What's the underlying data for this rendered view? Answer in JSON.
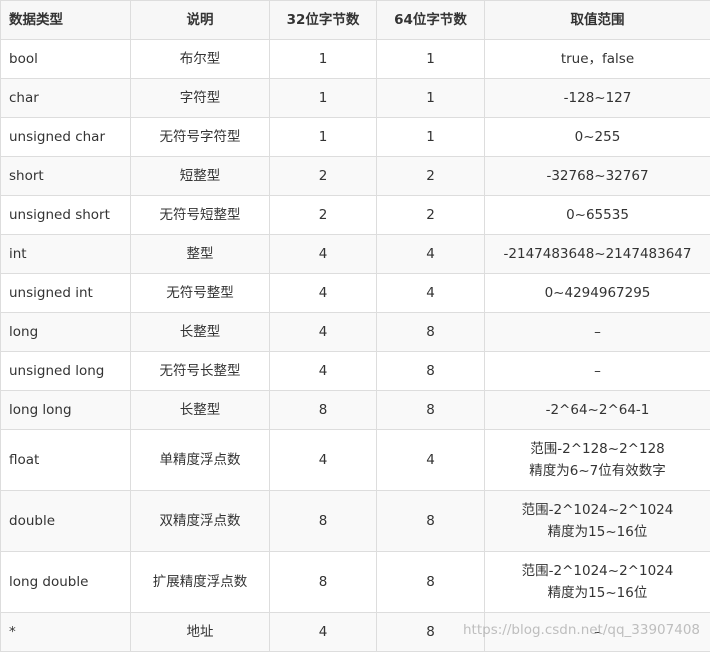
{
  "header": [
    "数据类型",
    "说明",
    "32位字节数",
    "64位字节数",
    "取值范围"
  ],
  "rows": [
    {
      "type": "bool",
      "desc": "布尔型",
      "b32": "1",
      "b64": "1",
      "range": [
        "true，false"
      ]
    },
    {
      "type": "char",
      "desc": "字符型",
      "b32": "1",
      "b64": "1",
      "range": [
        "-128~127"
      ]
    },
    {
      "type": "unsigned char",
      "desc": "无符号字符型",
      "b32": "1",
      "b64": "1",
      "range": [
        "0~255"
      ]
    },
    {
      "type": "short",
      "desc": "短整型",
      "b32": "2",
      "b64": "2",
      "range": [
        "-32768~32767"
      ]
    },
    {
      "type": "unsigned short",
      "desc": "无符号短整型",
      "b32": "2",
      "b64": "2",
      "range": [
        "0~65535"
      ]
    },
    {
      "type": "int",
      "desc": "整型",
      "b32": "4",
      "b64": "4",
      "range": [
        "-2147483648~2147483647"
      ]
    },
    {
      "type": "unsigned int",
      "desc": "无符号整型",
      "b32": "4",
      "b64": "4",
      "range": [
        "0~4294967295"
      ]
    },
    {
      "type": "long",
      "desc": "长整型",
      "b32": "4",
      "b64": "8",
      "range": [
        "–"
      ]
    },
    {
      "type": "unsigned long",
      "desc": "无符号长整型",
      "b32": "4",
      "b64": "8",
      "range": [
        "–"
      ]
    },
    {
      "type": "long long",
      "desc": "长整型",
      "b32": "8",
      "b64": "8",
      "range": [
        "-2^64~2^64-1"
      ]
    },
    {
      "type": "float",
      "desc": "单精度浮点数",
      "b32": "4",
      "b64": "4",
      "range": [
        "范围-2^128~2^128",
        "精度为6~7位有效数字"
      ]
    },
    {
      "type": "double",
      "desc": "双精度浮点数",
      "b32": "8",
      "b64": "8",
      "range": [
        "范围-2^1024~2^1024",
        "精度为15~16位"
      ]
    },
    {
      "type": "long double",
      "desc": "扩展精度浮点数",
      "b32": "8",
      "b64": "8",
      "range": [
        "范围-2^1024~2^1024",
        "精度为15~16位"
      ]
    },
    {
      "type": "*",
      "desc": "地址",
      "b32": "4",
      "b64": "8",
      "range": [
        "–"
      ]
    }
  ],
  "watermark": "https://blog.csdn.net/qq_33907408"
}
